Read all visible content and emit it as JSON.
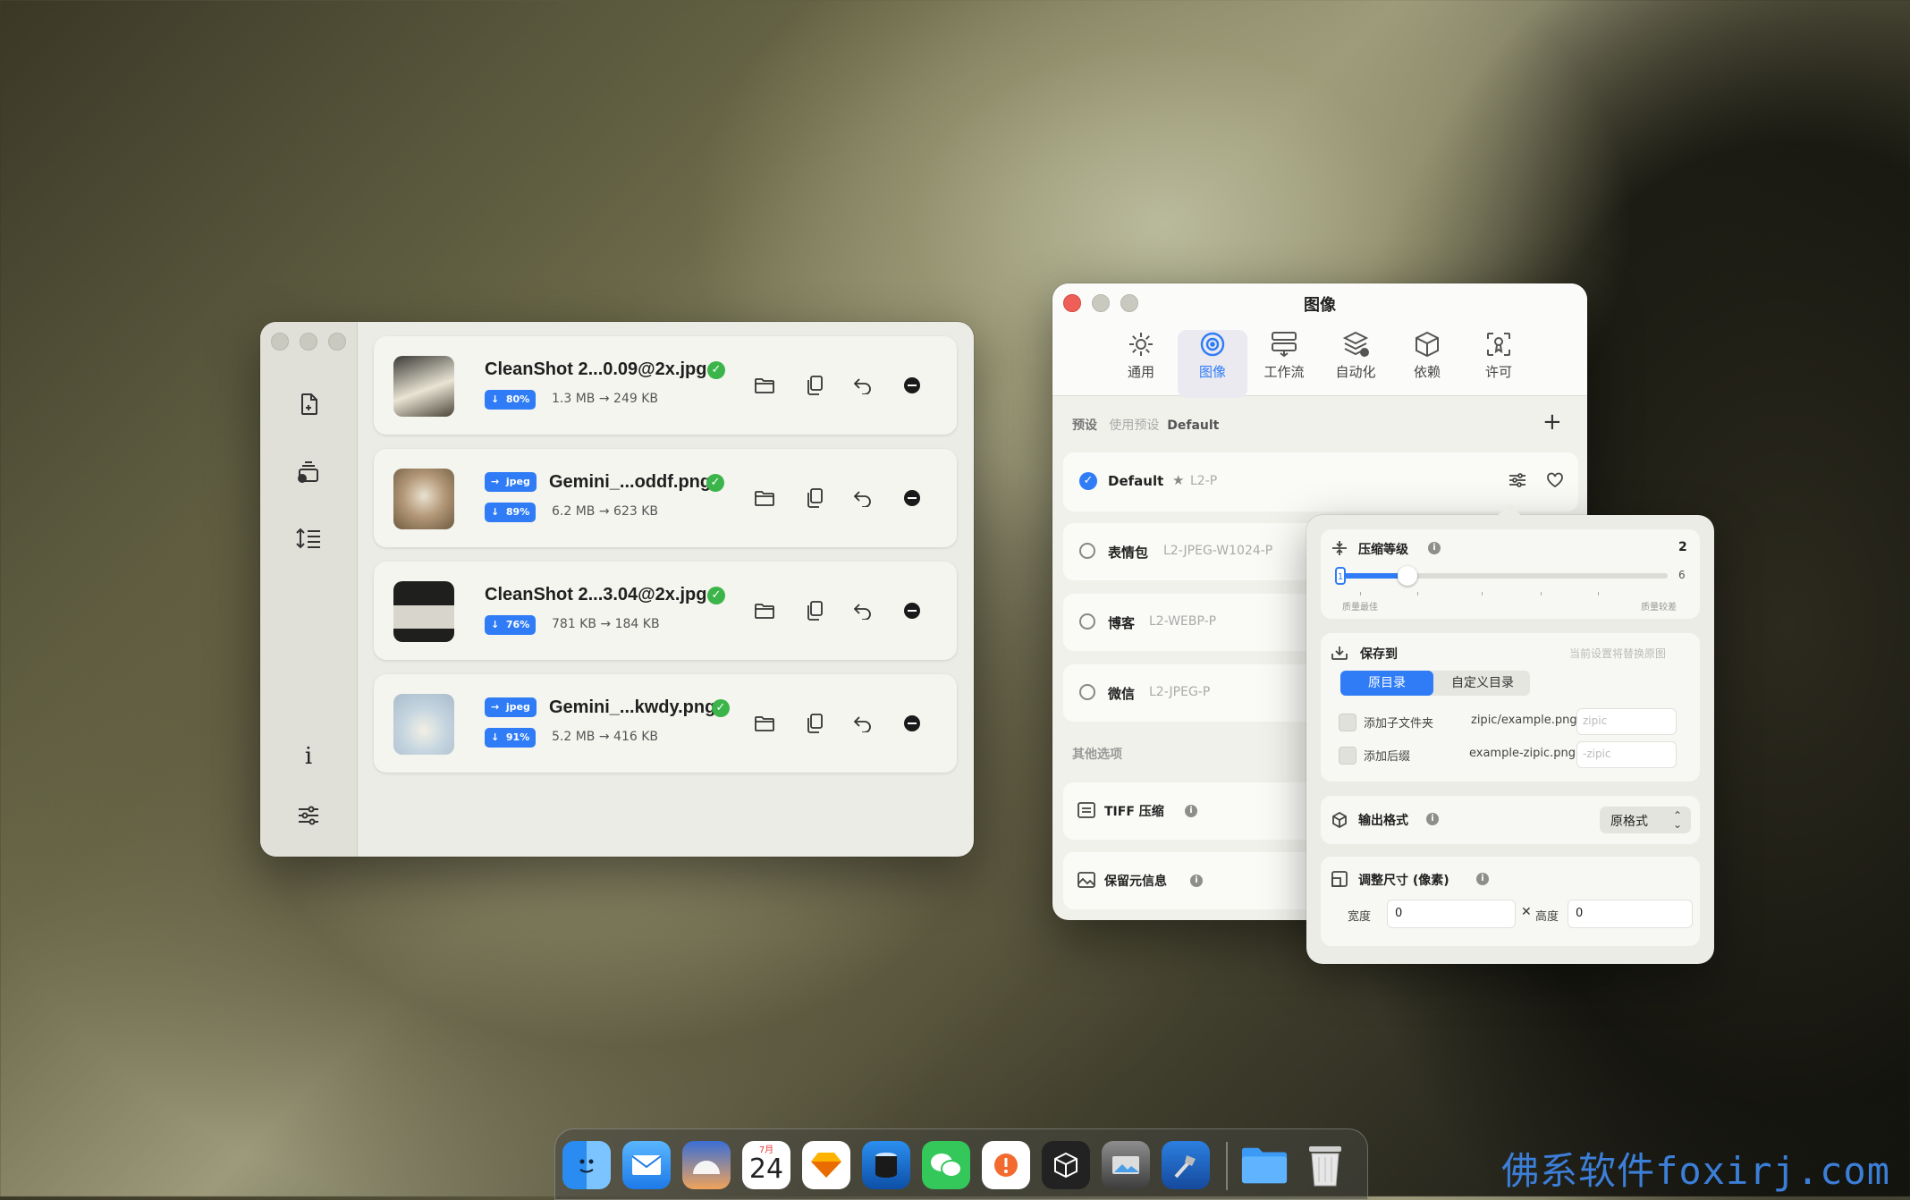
{
  "main_window": {
    "files": [
      {
        "name": "CleanShot 2...0.09@2x.jpg",
        "convert": "",
        "saving": "80%",
        "original": "1.3 MB",
        "result": "249 KB"
      },
      {
        "name": "Gemini_...oddf.png",
        "convert": "jpeg",
        "saving": "89%",
        "original": "6.2 MB",
        "result": "623 KB"
      },
      {
        "name": "CleanShot 2...3.04@2x.jpg",
        "convert": "",
        "saving": "76%",
        "original": "781 KB",
        "result": "184 KB"
      },
      {
        "name": "Gemini_...kwdy.png",
        "convert": "jpeg",
        "saving": "91%",
        "original": "5.2 MB",
        "result": "416 KB"
      }
    ],
    "arrow": "→",
    "down": "↓",
    "info_glyph": "i"
  },
  "settings": {
    "title": "图像",
    "tabs": [
      {
        "label": "通用",
        "icon": "gear-icon"
      },
      {
        "label": "图像",
        "icon": "image-icon"
      },
      {
        "label": "工作流",
        "icon": "workflow-icon"
      },
      {
        "label": "自动化",
        "icon": "automation-icon"
      },
      {
        "label": "依赖",
        "icon": "package-icon"
      },
      {
        "label": "许可",
        "icon": "license-icon"
      }
    ],
    "preset_label": "预设",
    "use_preset": "使用预设",
    "current_preset": "Default",
    "add_symbol": "+",
    "presets": [
      {
        "name": "Default",
        "star": "★",
        "code": "L2-P",
        "checked": true
      },
      {
        "name": "表情包",
        "code": "L2-JPEG-W1024-P",
        "checked": false
      },
      {
        "name": "博客",
        "code": "L2-WEBP-P",
        "checked": false
      },
      {
        "name": "微信",
        "code": "L2-JPEG-P",
        "checked": false
      }
    ],
    "other_options": "其他选项",
    "options": [
      {
        "label": "TIFF 压缩",
        "icon": "tiff-icon"
      },
      {
        "label": "保留元信息",
        "icon": "metadata-icon"
      }
    ]
  },
  "popover": {
    "compression": {
      "label": "压缩等级",
      "value": "2",
      "max": "6",
      "min_marker": "1",
      "level_fraction": 0.2,
      "left_caption": "质量最佳",
      "right_caption": "质量较差"
    },
    "save_to": {
      "label": "保存到",
      "hint": "当前设置将替换原图",
      "segments": [
        "原目录",
        "自定义目录"
      ],
      "selected": 0,
      "subfolder": {
        "label": "添加子文件夹",
        "example": "zipic/example.png",
        "placeholder": "zipic"
      },
      "suffix": {
        "label": "添加后缀",
        "example": "example-zipic.png",
        "placeholder": "-zipic"
      }
    },
    "output_format": {
      "label": "输出格式",
      "value": "原格式"
    },
    "resize": {
      "label": "调整尺寸 (像素)",
      "width_label": "宽度",
      "width_value": "0",
      "times": "✕",
      "height_label": "高度",
      "height_value": "0"
    }
  },
  "dock": {
    "apps": [
      "finder-icon",
      "mail-icon",
      "weather-icon",
      "calendar-icon",
      "sketch-icon",
      "app-icon",
      "wechat-icon",
      "app-icon-orange",
      "cube-app-icon",
      "preview-icon",
      "xcode-icon",
      "folder-icon",
      "trash-icon"
    ],
    "calendar_day": "24",
    "calendar_month": "7月"
  },
  "watermark": "佛系软件foxirj.com",
  "colors": {
    "accent": "#2f7cf6",
    "success": "#3bb54a",
    "close": "#ee5f57"
  }
}
